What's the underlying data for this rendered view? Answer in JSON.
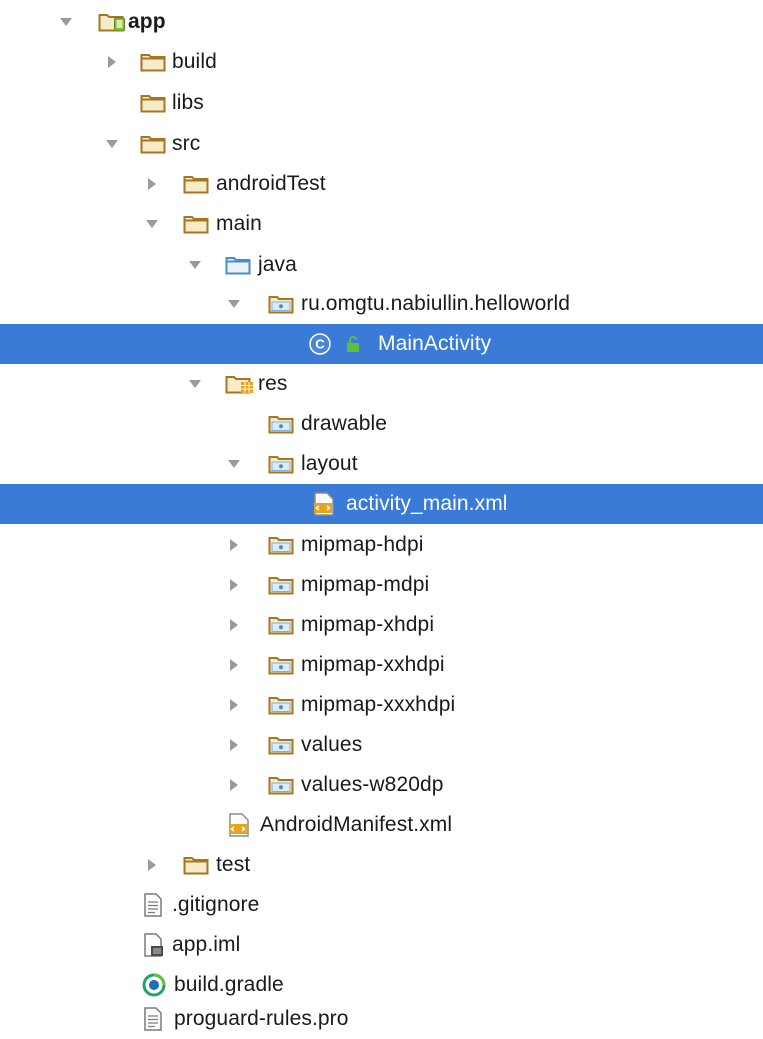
{
  "tree": {
    "root_label": "app",
    "build": "build",
    "libs": "libs",
    "src": "src",
    "androidTest": "androidTest",
    "main": "main",
    "java": "java",
    "package": "ru.omgtu.nabiullin.helloworld",
    "main_activity": "MainActivity",
    "res": "res",
    "drawable": "drawable",
    "layout": "layout",
    "activity_main": "activity_main.xml",
    "mipmap_hdpi": "mipmap-hdpi",
    "mipmap_mdpi": "mipmap-mdpi",
    "mipmap_xhdpi": "mipmap-xhdpi",
    "mipmap_xxhdpi": "mipmap-xxhdpi",
    "mipmap_xxxhdpi": "mipmap-xxxhdpi",
    "values": "values",
    "values_w820dp": "values-w820dp",
    "manifest": "AndroidManifest.xml",
    "test": "test",
    "gitignore": ".gitignore",
    "app_iml": "app.iml",
    "build_gradle": "build.gradle",
    "proguard": "proguard-rules.pro"
  },
  "class_badge": "C",
  "colors": {
    "selection": "#3b7bd8",
    "folder_outline": "#b07a2a",
    "folder_fill": "#f3e3b4",
    "source_folder": "#4a8ec9",
    "arrow": "#9a9a9a"
  }
}
